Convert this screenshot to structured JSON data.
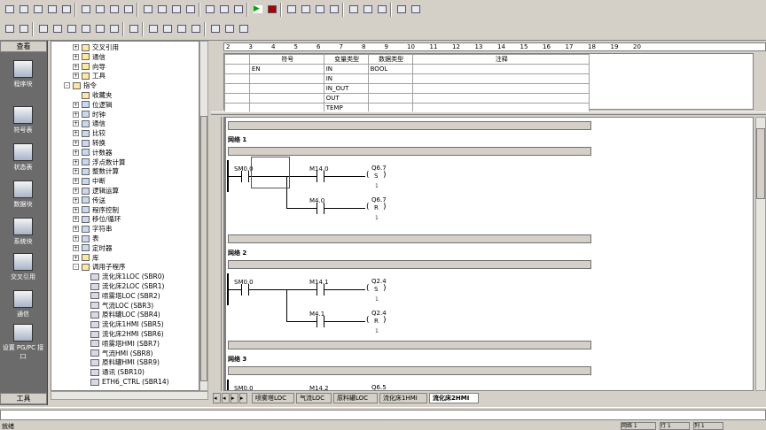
{
  "toolbar": {
    "row1_icons": [
      "new-icon",
      "open-icon",
      "save-icon",
      "print-icon",
      "preview-icon",
      "cut-icon",
      "copy-icon",
      "paste-icon",
      "undo-icon",
      "compile-icon",
      "compile-all-icon",
      "upload-icon",
      "download-icon",
      "sort-asc-icon",
      "sort-desc-icon",
      "options-icon",
      "run-icon",
      "stop-icon",
      "monitor-icon",
      "status-icon",
      "trend-icon",
      "watch-icon",
      "force-icon",
      "unforce-icon",
      "read-icon",
      "write-icon",
      "help-icon"
    ],
    "row2_icons": [
      "ladder-icon",
      "contact-icon",
      "coil-icon",
      "box-icon",
      "network-icon",
      "insert-icon",
      "delete-icon",
      "symbol-icon",
      "table-icon",
      "line-down-icon",
      "line-up-icon",
      "line-left-icon",
      "line-right-icon",
      "contact-insert-icon",
      "coil-insert-icon",
      "box-insert-icon"
    ]
  },
  "nav": {
    "header": "查看",
    "footer": "工具",
    "items": [
      {
        "label": "程序块",
        "icon": "program-block-icon"
      },
      {
        "label": "符号表",
        "icon": "symbol-table-icon"
      },
      {
        "label": "状态表",
        "icon": "status-table-icon"
      },
      {
        "label": "数据块",
        "icon": "data-block-icon"
      },
      {
        "label": "系统块",
        "icon": "system-block-icon"
      },
      {
        "label": "交叉引用",
        "icon": "cross-ref-icon"
      },
      {
        "label": "通信",
        "icon": "comm-icon"
      },
      {
        "label": "设置 PG/PC 接口",
        "icon": "pgpc-icon"
      }
    ]
  },
  "tree": {
    "items": [
      {
        "label": "交叉引用",
        "level": 1,
        "pm": "+",
        "kind": "normal"
      },
      {
        "label": "通信",
        "level": 1,
        "pm": "+",
        "kind": "normal"
      },
      {
        "label": "向导",
        "level": 1,
        "pm": "+",
        "kind": "normal"
      },
      {
        "label": "工具",
        "level": 1,
        "pm": "+",
        "kind": "normal"
      },
      {
        "label": "指令",
        "level": 0,
        "pm": "-",
        "kind": "normal"
      },
      {
        "label": "收藏夹",
        "level": 1,
        "pm": "",
        "kind": "normal"
      },
      {
        "label": "位逻辑",
        "level": 1,
        "pm": "+",
        "kind": "blue"
      },
      {
        "label": "时钟",
        "level": 1,
        "pm": "+",
        "kind": "blue"
      },
      {
        "label": "通信",
        "level": 1,
        "pm": "+",
        "kind": "blue"
      },
      {
        "label": "比较",
        "level": 1,
        "pm": "+",
        "kind": "blue"
      },
      {
        "label": "转换",
        "level": 1,
        "pm": "+",
        "kind": "blue"
      },
      {
        "label": "计数器",
        "level": 1,
        "pm": "+",
        "kind": "blue"
      },
      {
        "label": "浮点数计算",
        "level": 1,
        "pm": "+",
        "kind": "blue"
      },
      {
        "label": "整数计算",
        "level": 1,
        "pm": "+",
        "kind": "blue"
      },
      {
        "label": "中断",
        "level": 1,
        "pm": "+",
        "kind": "blue"
      },
      {
        "label": "逻辑运算",
        "level": 1,
        "pm": "+",
        "kind": "blue"
      },
      {
        "label": "传送",
        "level": 1,
        "pm": "+",
        "kind": "blue"
      },
      {
        "label": "程序控制",
        "level": 1,
        "pm": "+",
        "kind": "blue"
      },
      {
        "label": "移位/循环",
        "level": 1,
        "pm": "+",
        "kind": "blue"
      },
      {
        "label": "字符串",
        "level": 1,
        "pm": "+",
        "kind": "blue"
      },
      {
        "label": "表",
        "level": 1,
        "pm": "+",
        "kind": "blue"
      },
      {
        "label": "定时器",
        "level": 1,
        "pm": "+",
        "kind": "blue"
      },
      {
        "label": "库",
        "level": 1,
        "pm": "+",
        "kind": "normal"
      },
      {
        "label": "调用子程序",
        "level": 1,
        "pm": "-",
        "kind": "normal"
      },
      {
        "label": "流化床1LOC (SBR0)",
        "level": 2,
        "pm": "",
        "kind": "sub"
      },
      {
        "label": "流化床2LOC (SBR1)",
        "level": 2,
        "pm": "",
        "kind": "sub"
      },
      {
        "label": "喷雾塔LOC (SBR2)",
        "level": 2,
        "pm": "",
        "kind": "sub"
      },
      {
        "label": "气流LOC (SBR3)",
        "level": 2,
        "pm": "",
        "kind": "sub"
      },
      {
        "label": "原料罐LOC (SBR4)",
        "level": 2,
        "pm": "",
        "kind": "sub"
      },
      {
        "label": "流化床1HMI (SBR5)",
        "level": 2,
        "pm": "",
        "kind": "sub"
      },
      {
        "label": "流化床2HMI (SBR6)",
        "level": 2,
        "pm": "",
        "kind": "sub"
      },
      {
        "label": "喷雾塔HMI (SBR7)",
        "level": 2,
        "pm": "",
        "kind": "sub"
      },
      {
        "label": "气流HMI (SBR8)",
        "level": 2,
        "pm": "",
        "kind": "sub"
      },
      {
        "label": "原料罐HMI (SBR9)",
        "level": 2,
        "pm": "",
        "kind": "sub"
      },
      {
        "label": "通讯 (SBR10)",
        "level": 2,
        "pm": "",
        "kind": "sub"
      },
      {
        "label": "ETH6_CTRL (SBR14)",
        "level": 2,
        "pm": "",
        "kind": "sub"
      }
    ]
  },
  "ruler": [
    "2",
    "3",
    "4",
    "5",
    "6",
    "7",
    "8",
    "9",
    "10",
    "11",
    "12",
    "13",
    "14",
    "15",
    "16",
    "17",
    "18",
    "19",
    "20"
  ],
  "var_table": {
    "headers": [
      "符号",
      "变量类型",
      "数据类型",
      "注释"
    ],
    "rows": [
      [
        "EN",
        "IN",
        "BOOL",
        ""
      ],
      [
        "",
        "IN",
        "",
        ""
      ],
      [
        "",
        "IN_OUT",
        "",
        ""
      ],
      [
        "",
        "OUT",
        "",
        ""
      ],
      [
        "",
        "TEMP",
        "",
        ""
      ]
    ]
  },
  "networks": [
    {
      "title": "网络 1",
      "contact1": "SM0.0",
      "branch_a": {
        "contact": "M14.0",
        "coil": "Q6.7",
        "op": "S",
        "n": "1"
      },
      "branch_b": {
        "contact": "M4.0",
        "coil": "Q6.7",
        "op": "R",
        "n": "1"
      }
    },
    {
      "title": "网络 2",
      "contact1": "SM0.0",
      "branch_a": {
        "contact": "M14.1",
        "coil": "Q2.4",
        "op": "S",
        "n": "1"
      },
      "branch_b": {
        "contact": "M4.1",
        "coil": "Q2.4",
        "op": "R",
        "n": "1"
      }
    },
    {
      "title": "网络 3",
      "contact1": "SM0.0",
      "branch_a": {
        "contact": "M14.2",
        "coil": "Q6.5",
        "op": "",
        "n": ""
      }
    }
  ],
  "tabs": [
    "喷雾塔LOC",
    "气流LOC",
    "原料罐LOC",
    "流化床1HMI",
    "流化床2HMI"
  ],
  "status": {
    "left": "就绪",
    "right1": "网络 1",
    "right2": "行 1",
    "right3": "列 1"
  }
}
